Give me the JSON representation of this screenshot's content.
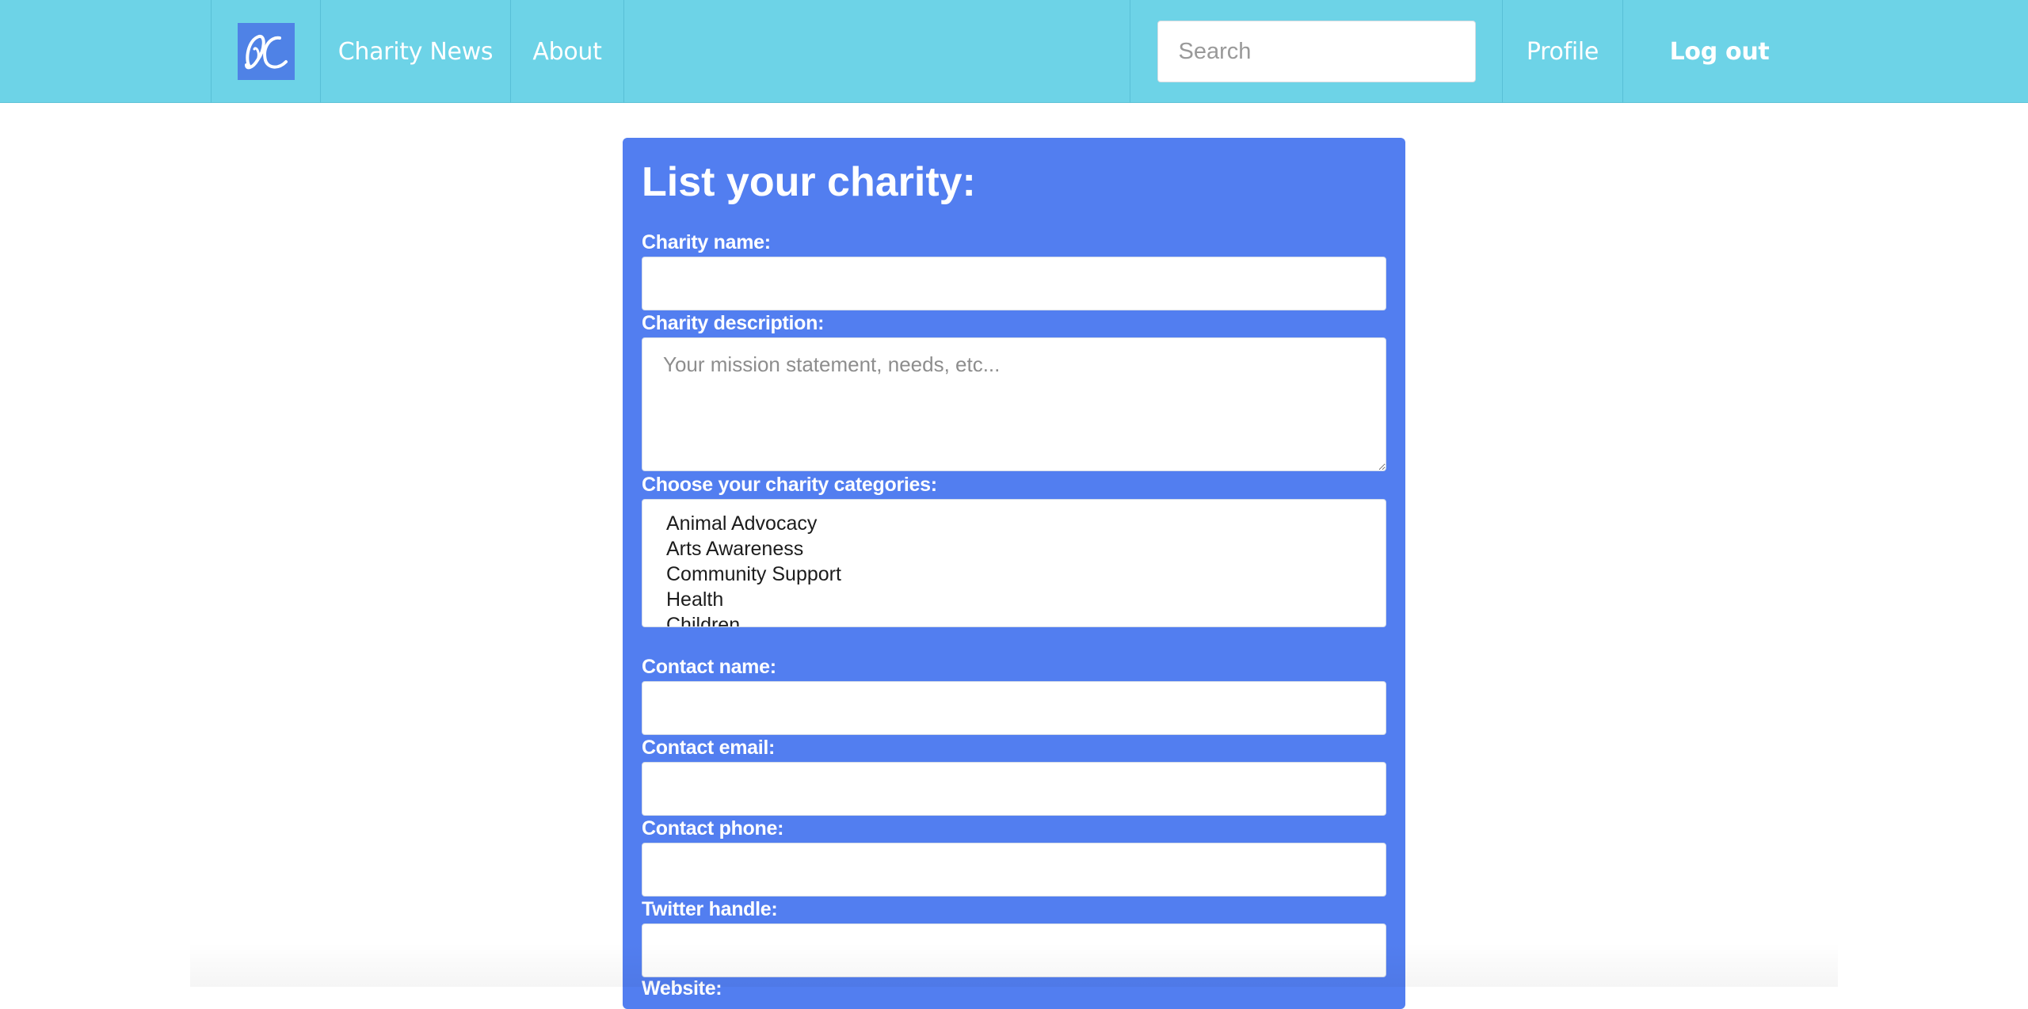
{
  "nav": {
    "logo_alt": "DC",
    "links": [
      {
        "label": "Charity News"
      },
      {
        "label": "About"
      }
    ],
    "search": {
      "placeholder": "Search",
      "value": ""
    },
    "profile_label": "Profile",
    "logout_label": "Log out"
  },
  "form": {
    "title": "List your charity:",
    "charity_name": {
      "label": "Charity name:",
      "value": ""
    },
    "charity_description": {
      "label": "Charity description:",
      "placeholder": "Your mission statement, needs, etc...",
      "value": ""
    },
    "categories": {
      "label": "Choose your charity categories:",
      "options": [
        "Animal Advocacy",
        "Arts Awareness",
        "Community Support",
        "Health",
        "Children"
      ]
    },
    "contact_name": {
      "label": "Contact name:",
      "value": ""
    },
    "contact_email": {
      "label": "Contact email:",
      "value": ""
    },
    "contact_phone": {
      "label": "Contact phone:",
      "value": ""
    },
    "twitter_handle": {
      "label": "Twitter handle:",
      "value": ""
    },
    "website": {
      "label": "Website:"
    }
  },
  "colors": {
    "navbar": "#6dd3e7",
    "panel": "#527ef0",
    "logo_bg": "#4f82e6"
  }
}
